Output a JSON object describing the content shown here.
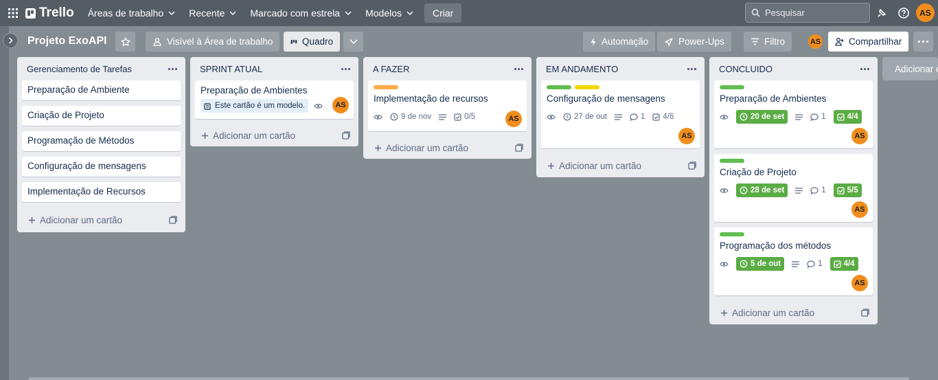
{
  "nav": {
    "brand": "Trello",
    "menus": [
      "Áreas de trabalho",
      "Recente",
      "Marcado com estrela",
      "Modelos"
    ],
    "create": "Criar",
    "search_placeholder": "Pesquisar",
    "user_initials": "AS"
  },
  "board": {
    "title": "Projeto ExoAPI",
    "visibility": "Visível à Área de trabalho",
    "view": "Quadro",
    "automation": "Automação",
    "powerups": "Power-Ups",
    "filter": "Filtro",
    "share": "Compartilhar",
    "member_initials": "AS"
  },
  "lists": [
    {
      "title": "Gerenciamento de Tarefas",
      "add": "Adicionar um cartão",
      "cards": [
        {
          "title": "Preparação de Ambiente"
        },
        {
          "title": "Criação de Projeto"
        },
        {
          "title": "Programação de Métodos"
        },
        {
          "title": "Configuração de mensagens"
        },
        {
          "title": "Implementação de Recursos"
        }
      ]
    },
    {
      "title": "SPRINT ATUAL",
      "add": "Adicionar um cartão",
      "cards": [
        {
          "title": "Preparação de Ambientes",
          "template_label": "Este cartão é um modelo.",
          "member": "AS"
        }
      ]
    },
    {
      "title": "A FAZER",
      "add": "Adicionar um cartão",
      "cards": [
        {
          "title": "Implementação de recursos",
          "labels": [
            "#ffab4a"
          ],
          "due": "9 de nov",
          "checklist": "0/5",
          "member": "AS"
        }
      ]
    },
    {
      "title": "EM ANDAMENTO",
      "add": "Adicionar um cartão",
      "cards": [
        {
          "title": "Configuração de mensagens",
          "labels": [
            "#61bd4f",
            "#f2d600"
          ],
          "due": "27 de out",
          "comments": "1",
          "checklist": "4/6",
          "member": "AS"
        }
      ]
    },
    {
      "title": "CONCLUIDO",
      "add": "Adicionar um cartão",
      "cards": [
        {
          "title": "Preparação de Ambientes",
          "labels": [
            "#61bd4f"
          ],
          "due": "20 de set",
          "comments": "1",
          "checklist": "4/4",
          "member": "AS"
        },
        {
          "title": "Criação de Projeto",
          "labels": [
            "#61bd4f"
          ],
          "due": "28 de set",
          "comments": "1",
          "checklist": "5/5",
          "member": "AS"
        },
        {
          "title": "Programação dos métodos",
          "labels": [
            "#61bd4f"
          ],
          "due": "5 de out",
          "comments": "1",
          "checklist": "4/4",
          "member": "AS"
        }
      ]
    }
  ],
  "add_list": "Adicionar outra lista",
  "colors": {
    "nav_bg": "#545c64",
    "board_bg": "#838c91",
    "avatar": "#f08d1e",
    "complete": "#5aac44"
  }
}
